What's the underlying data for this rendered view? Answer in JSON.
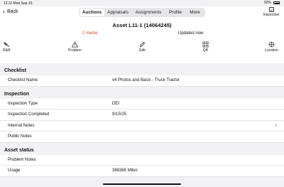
{
  "status_bar": {
    "time": "12:11",
    "date": "Mon Sep 15",
    "battery": "92%"
  },
  "nav": {
    "back_label": "Back",
    "inspection_label": "Inspection"
  },
  "tabs": [
    {
      "label": "Auctions",
      "active": true
    },
    {
      "label": "Appraisals",
      "active": false
    },
    {
      "label": "Assignments",
      "active": false
    },
    {
      "label": "Profile",
      "active": false
    },
    {
      "label": "More",
      "active": false
    }
  ],
  "asset": {
    "title": "Asset L11-1 (14064245)",
    "media": "2 media",
    "updated": "Updated now"
  },
  "actions": [
    {
      "label": "R&R",
      "icon": "wrench-icon"
    },
    {
      "label": "Problem",
      "icon": "warning-icon"
    },
    {
      "label": "Edit",
      "icon": "pencil-icon"
    },
    {
      "label": "QR",
      "icon": "qr-icon"
    },
    {
      "label": "Location",
      "icon": "location-icon"
    }
  ],
  "checklist": {
    "header": "Checklist",
    "name_label": "Checklist Name",
    "name_value": "v4 Photos and Basic - Truck Tractor"
  },
  "inspection": {
    "header": "Inspection",
    "type_label": "Inspection Type",
    "type_value": "DEI",
    "completed_label": "Inspection Completed",
    "completed_value": "9/15/25",
    "internal_notes_label": "Internal Notes",
    "public_notes_label": "Public Notes"
  },
  "asset_status": {
    "header": "Asset status",
    "problem_notes_label": "Problem Notes",
    "usage_label": "Usage",
    "usage_value": "388365 Miles"
  },
  "colors": {
    "media": "#e0473b",
    "background": "#f2f2f4"
  }
}
